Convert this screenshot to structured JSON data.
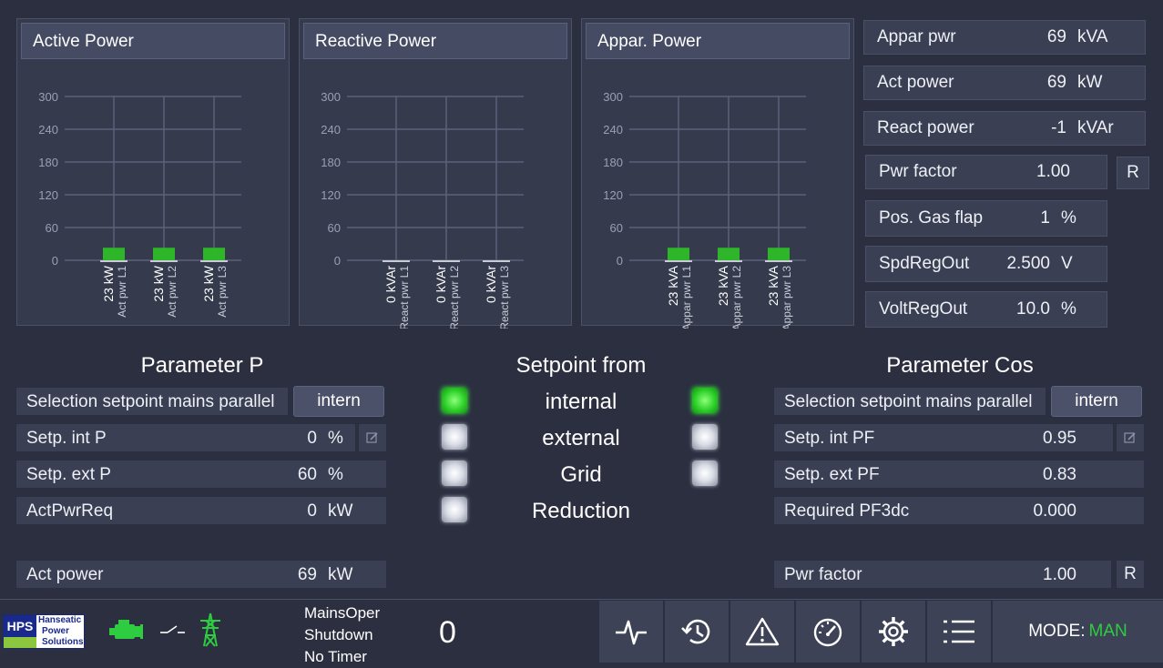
{
  "charts": [
    {
      "title": "Active Power",
      "chart_data": {
        "type": "bar",
        "title": "Active Power",
        "ylim": [
          0,
          300
        ],
        "yticks": [
          0,
          60,
          120,
          180,
          240,
          300
        ],
        "categories": [
          "Act pwr L1",
          "Act pwr L2",
          "Act pwr L3"
        ],
        "values": [
          23,
          23,
          23
        ],
        "value_labels": [
          "23 kW",
          "23 kW",
          "23 kW"
        ],
        "grid": true
      }
    },
    {
      "title": "Reactive Power",
      "chart_data": {
        "type": "bar",
        "title": "Reactive Power",
        "ylim": [
          0,
          300
        ],
        "yticks": [
          0,
          60,
          120,
          180,
          240,
          300
        ],
        "categories": [
          "React pwr L1",
          "React pwr L2",
          "React pwr L3"
        ],
        "values": [
          0,
          0,
          0
        ],
        "value_labels": [
          "0 kVAr",
          "0 kVAr",
          "0 kVAr"
        ],
        "grid": true
      }
    },
    {
      "title": "Appar. Power",
      "chart_data": {
        "type": "bar",
        "title": "Appar. Power",
        "ylim": [
          0,
          300
        ],
        "yticks": [
          0,
          60,
          120,
          180,
          240,
          300
        ],
        "categories": [
          "Appar pwr L1",
          "Appar pwr L2",
          "Appar pwr L3"
        ],
        "values": [
          23,
          23,
          23
        ],
        "value_labels": [
          "23 kVA",
          "23 kVA",
          "23 kVA"
        ],
        "grid": true
      }
    }
  ],
  "values_panel": [
    {
      "label": "Appar pwr",
      "value": "69",
      "unit": "kVA"
    },
    {
      "label": "Act power",
      "value": "69",
      "unit": "kW"
    },
    {
      "label": "React power",
      "value": "-1",
      "unit": "kVAr"
    },
    {
      "label": "Pwr factor",
      "value": "1.00",
      "unit": "",
      "reset": "R"
    },
    {
      "label": "Pos. Gas flap",
      "value": "1",
      "unit": "%"
    },
    {
      "label": "SpdRegOut",
      "value": "2.500",
      "unit": "V"
    },
    {
      "label": "VoltRegOut",
      "value": "10.0",
      "unit": "%"
    }
  ],
  "param_p": {
    "title": "Parameter P",
    "selection_label": "Selection setpoint mains parallel",
    "selection_value": "intern",
    "rows": [
      {
        "label": "Setp. int P",
        "value": "0",
        "unit": "%"
      },
      {
        "label": "Setp. ext P",
        "value": "60",
        "unit": "%"
      },
      {
        "label": "ActPwrReq",
        "value": "0",
        "unit": "kW"
      }
    ],
    "act_power": {
      "label": "Act power",
      "value": "69",
      "unit": "kW"
    }
  },
  "setpoint_from": {
    "title": "Setpoint from",
    "items": [
      {
        "label": "internal",
        "left_led": "on",
        "right_led": "on"
      },
      {
        "label": "external",
        "left_led": "off",
        "right_led": "off"
      },
      {
        "label": "Grid",
        "left_led": "off",
        "right_led": "off"
      },
      {
        "label": "Reduction",
        "left_led": "off",
        "right_led": "none"
      }
    ]
  },
  "param_cos": {
    "title": "Parameter Cos",
    "selection_label": "Selection setpoint mains parallel",
    "selection_value": "intern",
    "rows": [
      {
        "label": "Setp. int PF",
        "value": "0.95"
      },
      {
        "label": "Setp. ext PF",
        "value": "0.83"
      },
      {
        "label": "Required PF3dc",
        "value": "0.000"
      }
    ],
    "pwr_factor": {
      "label": "Pwr factor",
      "value": "1.00",
      "reset": "R"
    }
  },
  "footer": {
    "logo": {
      "abbr": "HPS",
      "line1": "Hanseatic",
      "line2": "Power",
      "line3": "Solutions"
    },
    "status": [
      "MainsOper",
      "Shutdown",
      "No Timer"
    ],
    "counter": "0",
    "mode_label": "MODE:",
    "mode_value": "MAN",
    "nav_icons": [
      "pulse-icon",
      "history-icon",
      "warning-icon",
      "gauge-icon",
      "settings-icon",
      "menu-list-icon"
    ],
    "colors": {
      "engine": "#2ecc40",
      "grid": "#2ecc40",
      "mode": "#2ecc40"
    }
  }
}
